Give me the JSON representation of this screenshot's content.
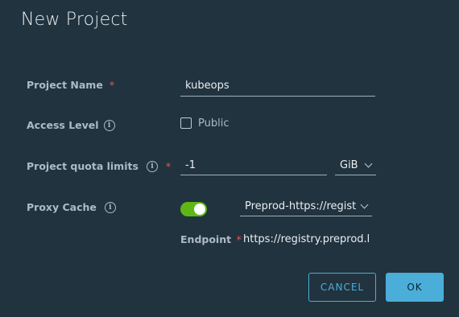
{
  "dialog": {
    "title": "New Project"
  },
  "form": {
    "project_name": {
      "label": "Project Name",
      "required_mark": "*",
      "value": "kubeops"
    },
    "access_level": {
      "label": "Access Level",
      "info_icon": "info-icon",
      "checkbox_label": "Public",
      "checked": false
    },
    "quota": {
      "label": "Project quota limits",
      "info_icon": "info-icon",
      "required_mark": "*",
      "value": "-1",
      "unit": "GiB"
    },
    "proxy_cache": {
      "label": "Proxy Cache",
      "info_icon": "info-icon",
      "enabled": true,
      "registry": "Preprod-https://regist"
    },
    "endpoint": {
      "label": "Endpoint",
      "required_mark": "*",
      "value": "https://registry.preprod.k"
    }
  },
  "buttons": {
    "cancel": "CANCEL",
    "ok": "OK"
  },
  "colors": {
    "background": "#21333f",
    "accent": "#4aaed9",
    "toggle_on": "#5eb715",
    "required": "#e5584b"
  }
}
